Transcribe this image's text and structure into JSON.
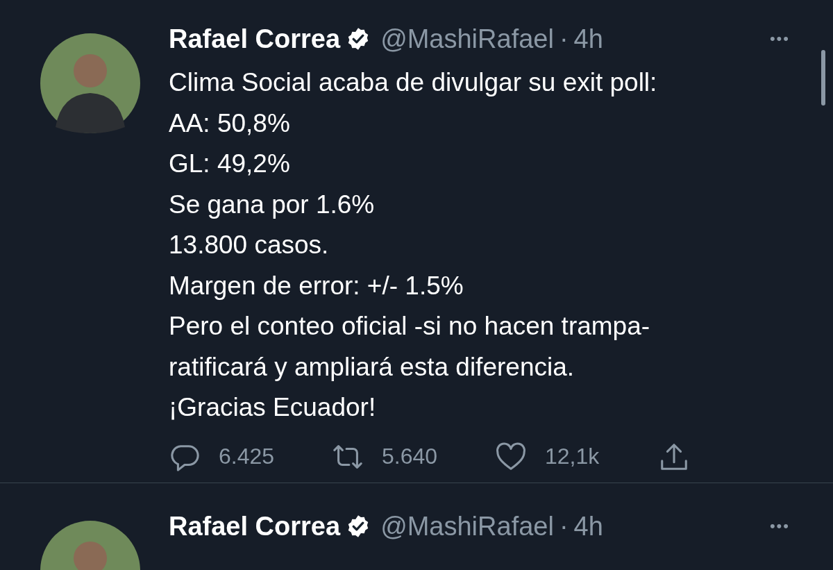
{
  "tweets": [
    {
      "name": "Rafael Correa",
      "verified": true,
      "handle": "@MashiRafael",
      "separator": "·",
      "time": "4h",
      "more": "•••",
      "lines": [
        "Clima Social acaba de divulgar su exit poll:",
        "AA: 50,8%",
        "GL: 49,2%",
        "Se gana por 1.6%",
        "13.800 casos.",
        "Margen de error: +/- 1.5%",
        "Pero el conteo oficial -si no hacen trampa-",
        "ratificará y ampliará esta diferencia.",
        "¡Gracias Ecuador!"
      ],
      "stats": [
        {
          "kind": "reply",
          "count": "6.425"
        },
        {
          "kind": "retweet",
          "count": "5.640"
        },
        {
          "kind": "like",
          "count": "12,1k"
        },
        {
          "kind": "share"
        }
      ]
    },
    {
      "name": "Rafael Correa",
      "verified": true,
      "handle": "@MashiRafael",
      "separator": "·",
      "time": "4h",
      "more": "•••"
    }
  ]
}
